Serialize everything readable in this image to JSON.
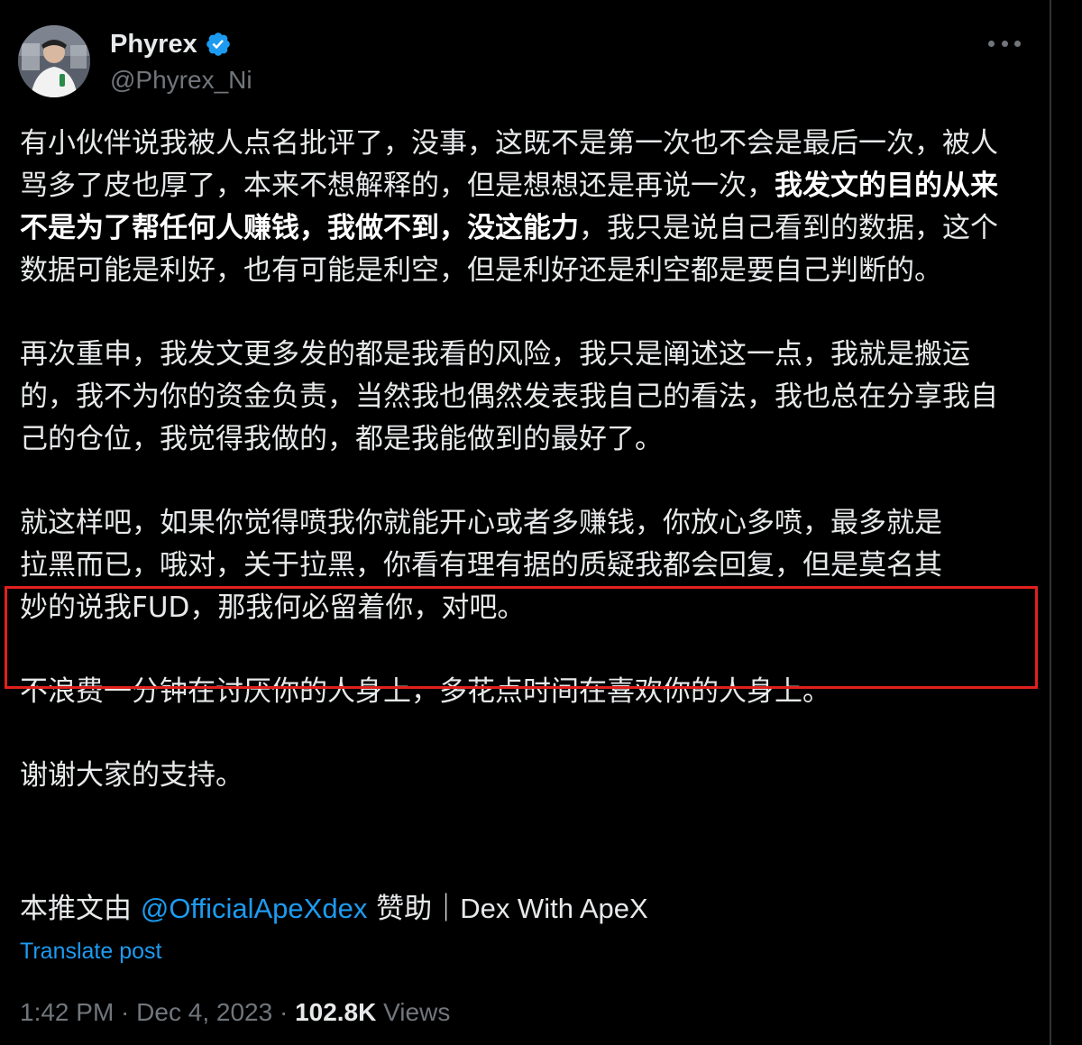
{
  "colors": {
    "background": "#000000",
    "text": "#e7e9ea",
    "secondary": "#71767b",
    "link": "#1d9bf0",
    "verified": "#1d9bf0",
    "highlight_border": "#e0201f"
  },
  "author": {
    "display_name": "Phyrex",
    "handle": "@Phyrex_Ni",
    "verified_icon": "verified-badge-icon",
    "avatar_icon": "user-avatar"
  },
  "more_icon": "more-horizontal-icon",
  "body": {
    "p1_part1": "有小伙伴说我被人点名批评了，没事，这既不是第一次也不会是最后一次，被人骂多了皮也厚了，本来不想解释的，但是想想还是再说一次，",
    "p1_bold": "我发文的目的从来不是为了帮任何人赚钱，我做不到，没这能力",
    "p1_part2": "，我只是说自己看到的数据，这个数据可能是利好，也有可能是利空，但是利好还是利空都是要自己判断的。",
    "p2": "再次重申，我发文更多发的都是我看的风险，我只是阐述这一点，我就是搬运的，我不为你的资金负责，当然我也偶然发表我自己的看法，我也总在分享我自己的仓位，我觉得我做的，都是我能做到的最好了。",
    "p3_line1": "就这样吧，如果你觉得喷我你就能开心或者多赚钱，你放心多喷，最多就是",
    "p3_line2": "拉黑而已，哦对，关于拉黑，你看有理有据的质疑我都会回复，但是莫名其",
    "p3_line3": "妙的说我FUD，那我何必留着你，对吧。",
    "p4": "不浪费一分钟在讨厌你的人身上，多花点时间在喜欢你的人身上。",
    "p5": "谢谢大家的支持。"
  },
  "sponsor": {
    "prefix": "本推文由 ",
    "mention": "@OfficialApeXdex",
    "middle": " 赞助｜",
    "suffix": "Dex With ApeX"
  },
  "translate_label": "Translate post",
  "meta": {
    "time": "1:42 PM",
    "sep1": " · ",
    "date": "Dec 4, 2023",
    "sep2": " · ",
    "views_count": "102.8K",
    "views_label": " Views"
  }
}
